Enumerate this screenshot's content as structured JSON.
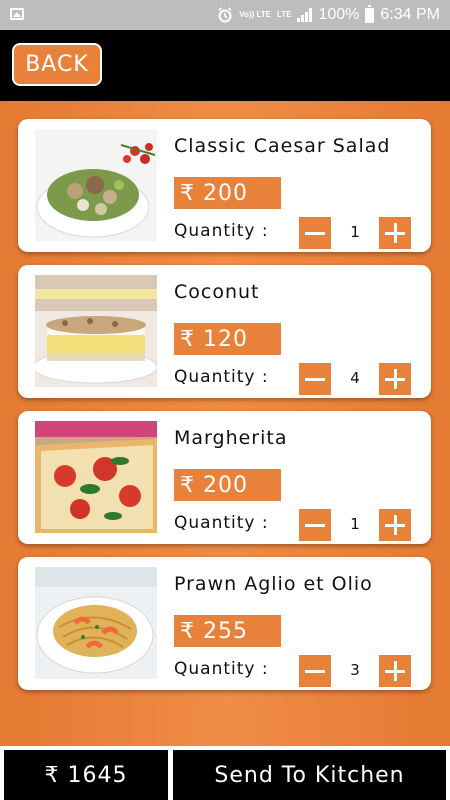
{
  "status_bar": {
    "volte": "Vo)) LTE",
    "lte": "LTE",
    "battery": "100%",
    "time": "6:34 PM"
  },
  "header": {
    "back_label": "BACK"
  },
  "quantity_label": "Quantity :",
  "items": [
    {
      "name": "Classic Caesar Salad",
      "price": "₹ 200",
      "quantity": "1",
      "image": "caesar-salad-photo"
    },
    {
      "name": "Coconut",
      "price": "₹ 120",
      "quantity": "4",
      "image": "coconut-cake-photo"
    },
    {
      "name": "Margherita",
      "price": "₹ 200",
      "quantity": "1",
      "image": "margherita-pizza-photo"
    },
    {
      "name": "Prawn Aglio et Olio",
      "price": "₹ 255",
      "quantity": "3",
      "image": "prawn-pasta-photo"
    }
  ],
  "footer": {
    "total": "₹ 1645",
    "send_label": "Send To Kitchen"
  },
  "colors": {
    "accent": "#e8823a",
    "bar": "#000000",
    "card": "#ffffff"
  }
}
